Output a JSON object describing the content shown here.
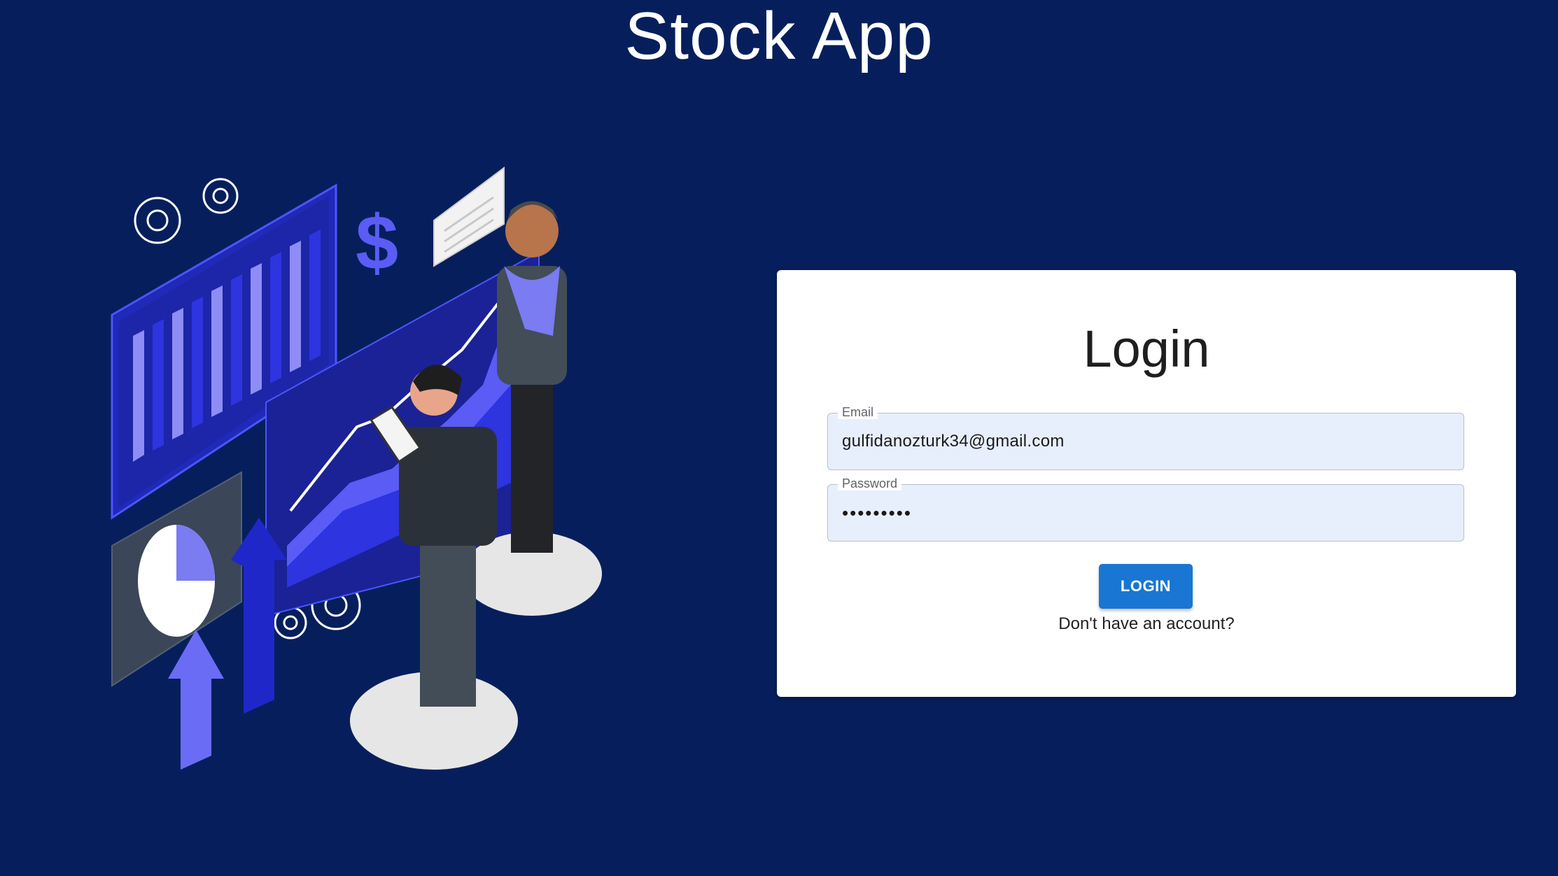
{
  "app": {
    "title": "Stock App"
  },
  "login": {
    "heading": "Login",
    "email_label": "Email",
    "email_value": "gulfidanozturk34@gmail.com",
    "password_label": "Password",
    "password_value": "•••••••••",
    "button_label": "LOGIN",
    "signup_text": "Don't have an account?"
  },
  "colors": {
    "background": "#061f5c",
    "accent": "#1976d2",
    "input_fill": "#e8effc"
  },
  "illustration": {
    "icons": [
      "gear-icon",
      "dollar-icon",
      "chat-bubble-icon",
      "bar-chart",
      "line-chart",
      "pie-chart",
      "arrow-up-icon"
    ]
  }
}
